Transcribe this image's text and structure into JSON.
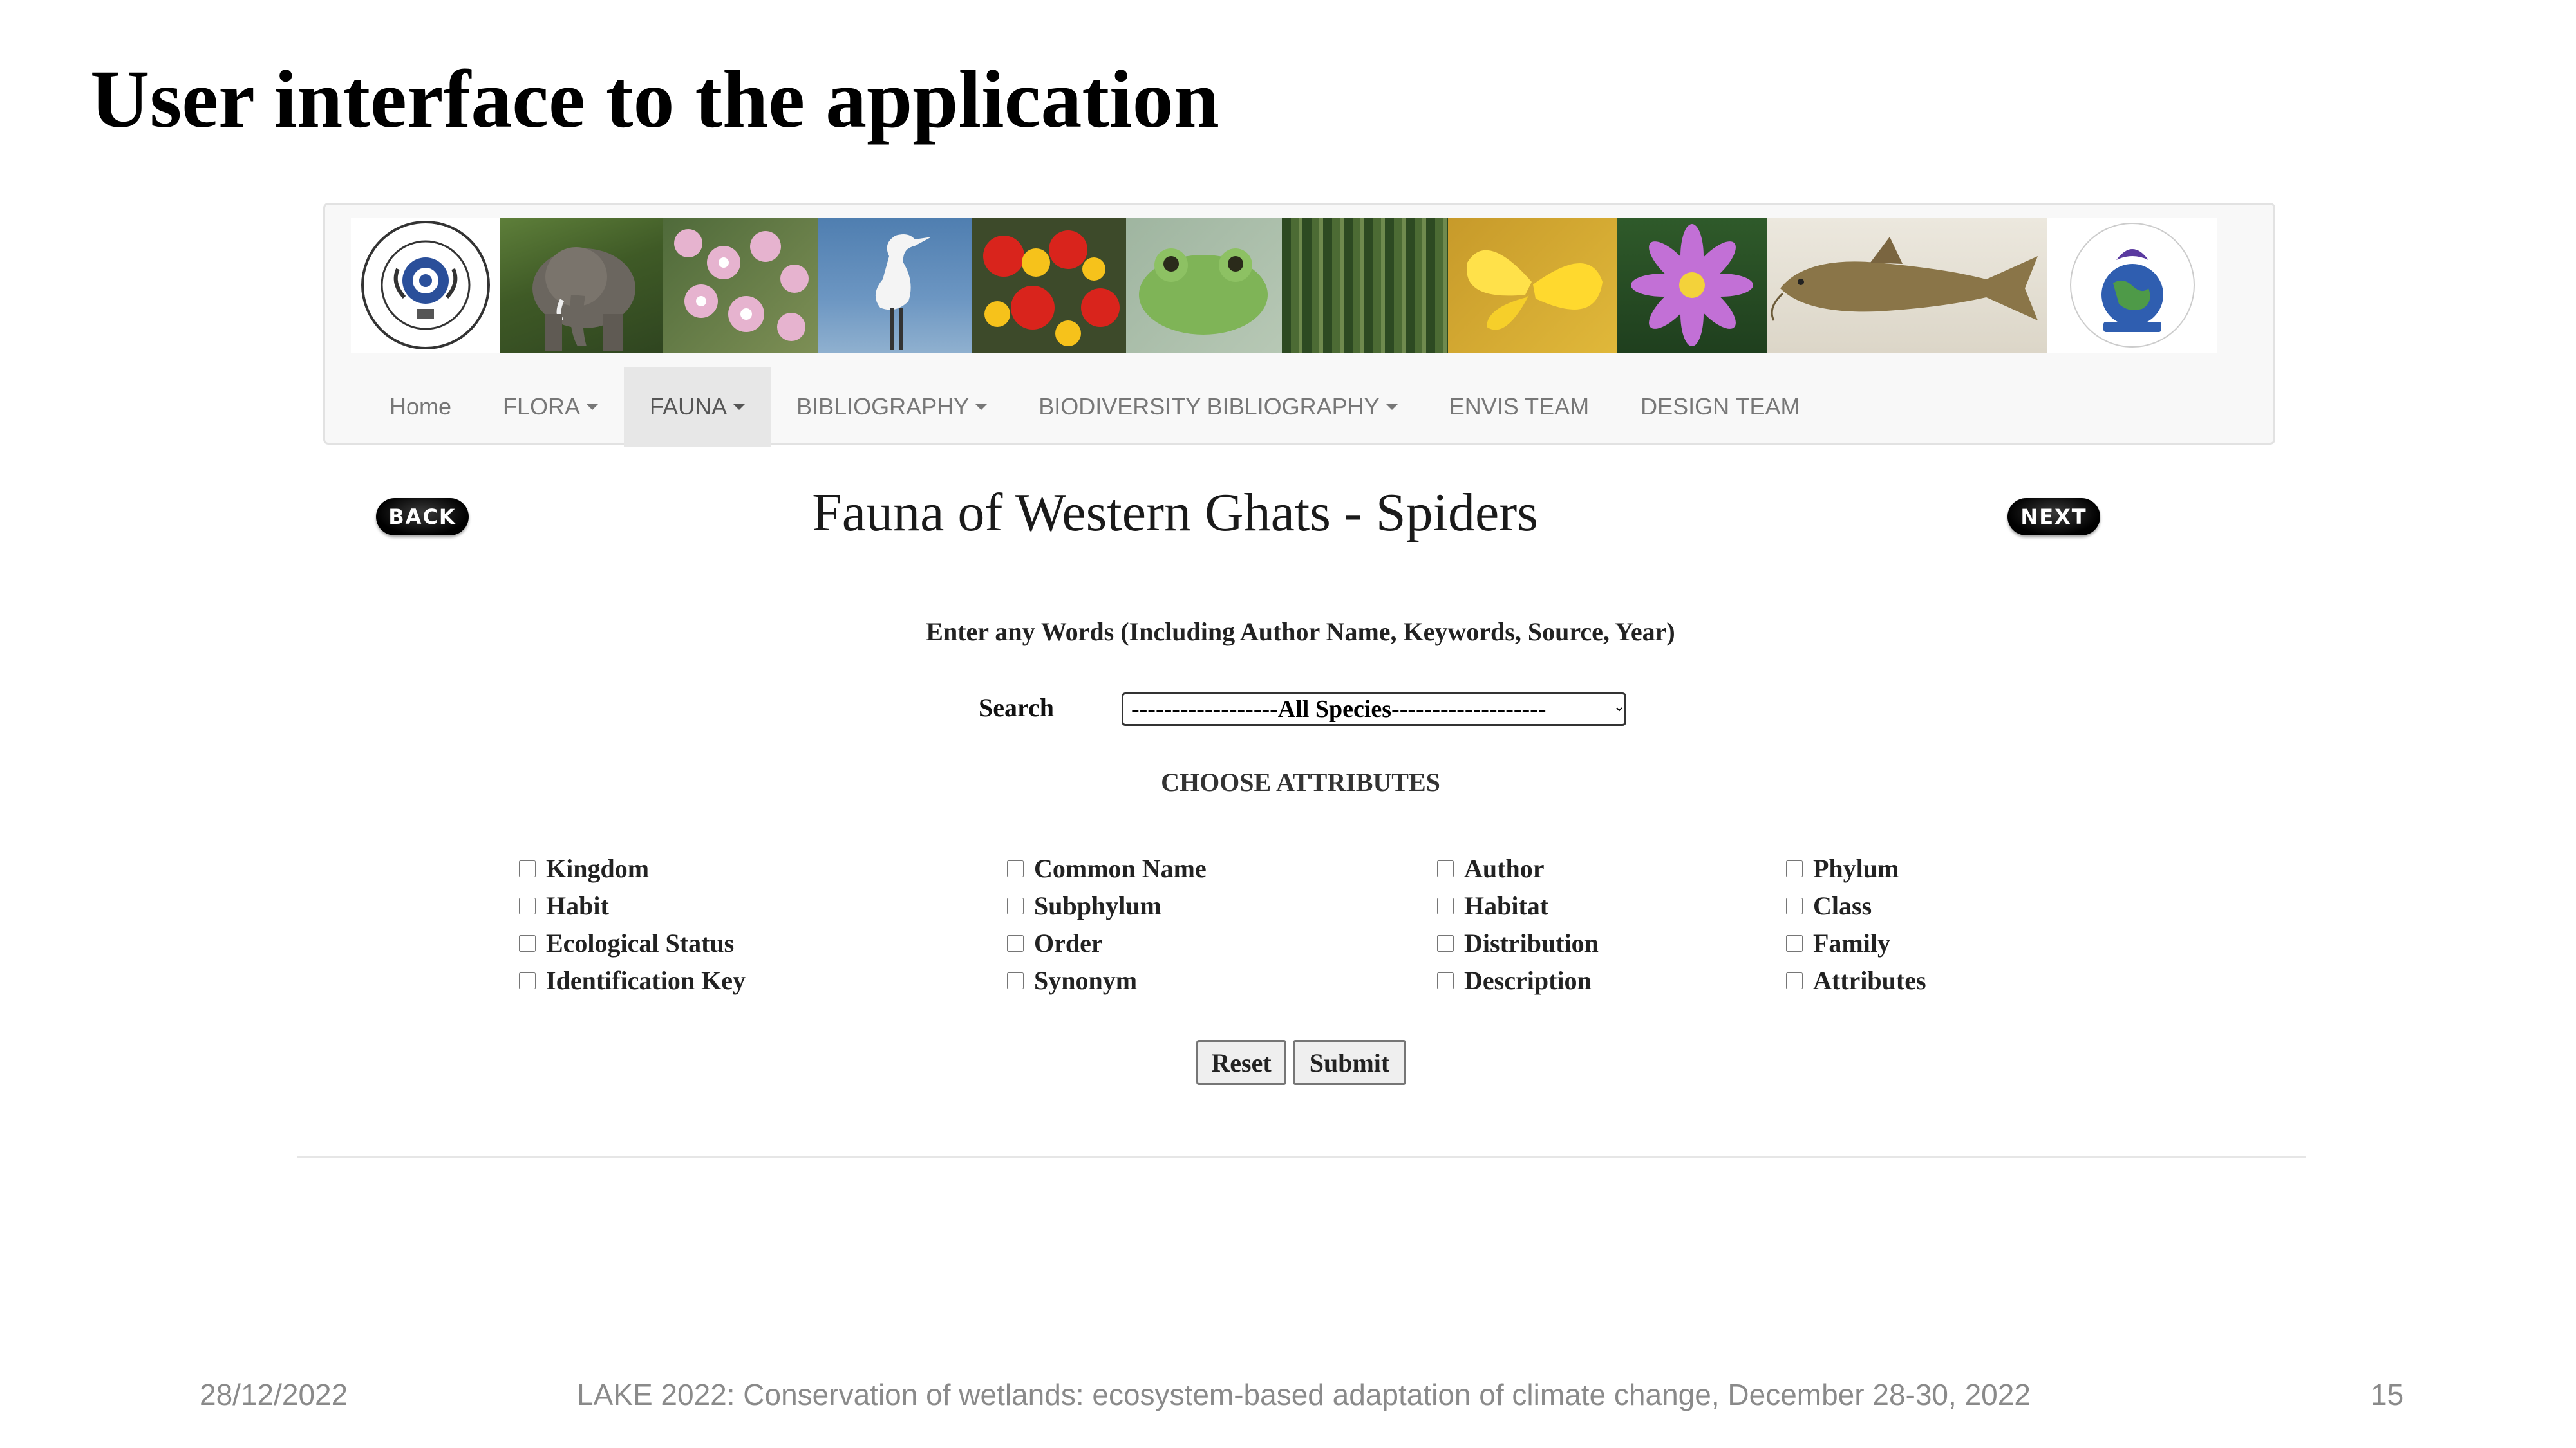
{
  "slide": {
    "title": "User interface to the application",
    "footer": {
      "date": "28/12/2022",
      "conference": "LAKE 2022: Conservation of wetlands: ecosystem-based adaptation of climate change, December 28-30, 2022",
      "page_number": "15"
    }
  },
  "nav": {
    "items": [
      {
        "label": "Home",
        "dropdown": false,
        "active": false
      },
      {
        "label": "FLORA",
        "dropdown": true,
        "active": false
      },
      {
        "label": "FAUNA",
        "dropdown": true,
        "active": true
      },
      {
        "label": "BIBLIOGRAPHY",
        "dropdown": true,
        "active": false
      },
      {
        "label": "BIODIVERSITY BIBLIOGRAPHY",
        "dropdown": true,
        "active": false
      },
      {
        "label": "ENVIS TEAM",
        "dropdown": false,
        "active": false
      },
      {
        "label": "DESIGN TEAM",
        "dropdown": false,
        "active": false
      }
    ]
  },
  "page": {
    "back_label": "BACK",
    "next_label": "NEXT",
    "heading": "Fauna of Western Ghats - Spiders",
    "instruction": "Enter any Words (Including Author Name, Keywords, Source, Year)",
    "search_label": "Search",
    "search_select": "------------------All Species-------------------",
    "attributes_heading": "CHOOSE ATTRIBUTES",
    "attributes": [
      [
        "Kingdom",
        "Common Name",
        "Author",
        "Phylum"
      ],
      [
        "Habit",
        "Subphylum",
        "Habitat",
        "Class"
      ],
      [
        "Ecological Status",
        "Order",
        "Distribution",
        "Family"
      ],
      [
        "Identification Key",
        "Synonym",
        "Description",
        "Attributes"
      ]
    ],
    "reset_label": "Reset",
    "submit_label": "Submit"
  },
  "banner_images": [
    "emblem-logo",
    "elephant",
    "pink-orchids",
    "white-crane",
    "red-yellow-flowers",
    "green-frog",
    "forest",
    "yellow-butterfly",
    "purple-water-lily",
    "catfish",
    "envis-globe-logo"
  ]
}
